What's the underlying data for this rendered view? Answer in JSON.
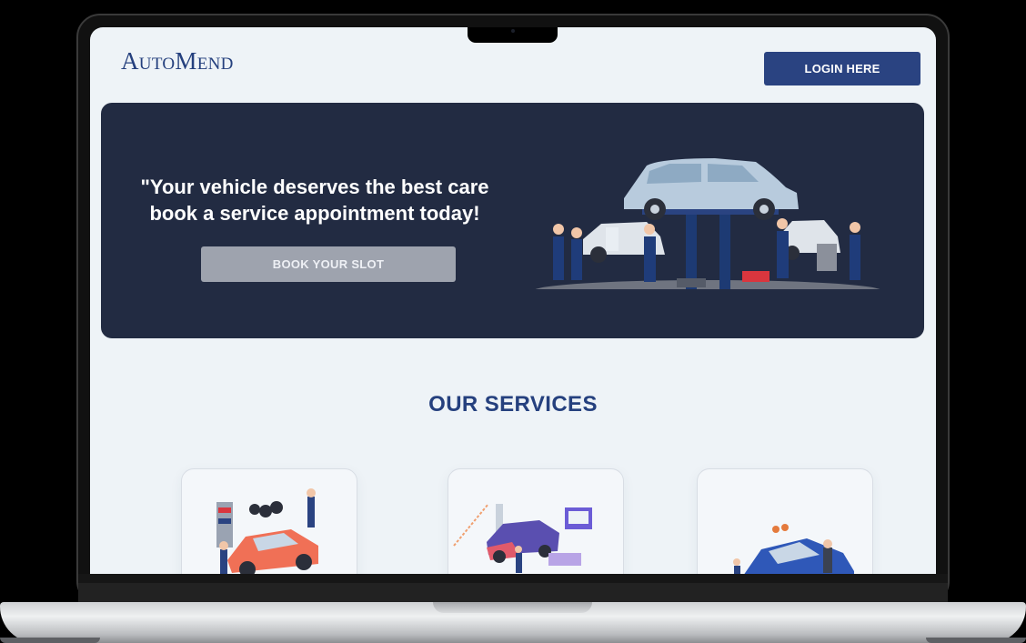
{
  "brand": {
    "name": "AutoMend"
  },
  "header": {
    "login_label": "LOGIN HERE"
  },
  "hero": {
    "headline_line1": "\"Your vehicle deserves the best care",
    "headline_line2": "book a service appointment today!",
    "cta_label": "BOOK YOUR SLOT",
    "illustration": "car-lift-mechanics-illustration"
  },
  "services": {
    "title": "OUR SERVICES",
    "cards": [
      {
        "illustration": "car-repair-tires-illustration"
      },
      {
        "illustration": "car-lift-diagnostics-illustration"
      },
      {
        "illustration": "car-body-repair-illustration"
      }
    ]
  },
  "colors": {
    "brand": "#25407e",
    "button": "#2a4381",
    "hero_bg": "#222b42",
    "page_bg": "#eef3f7",
    "cta_bg": "#9ea3ae"
  }
}
